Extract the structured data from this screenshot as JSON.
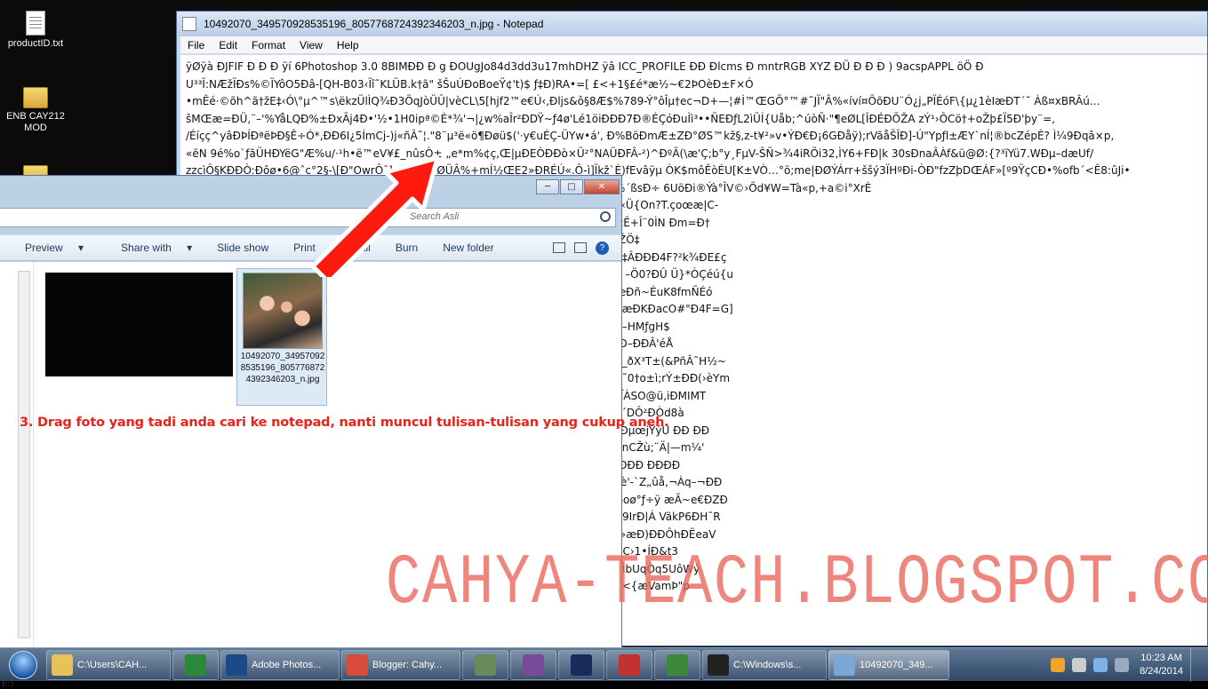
{
  "desktop": {
    "icons": [
      {
        "label": "productID.txt"
      },
      {
        "label": "ENB CAY212 MOD"
      }
    ]
  },
  "notepad": {
    "title": "10492070_349570928535196_8057768724392346203_n.jpg - Notepad",
    "menu": [
      "File",
      "Edit",
      "Format",
      "View",
      "Help"
    ],
    "lines": [
      "ÿØÿà ÐJFIF Ð    Ð Ð   ÿí 6Photoshop 3.0 8BIMÐÐ     Ð  g ÐOUgJo84d3dd3u17mhDHZ ÿâ  ICC_PROFILE ÐÐ     Ðlcms  Ð   mntrRGB XYZ ÐÜ Ð Ð  Ð ) 9acspAPPL                                 öÖ Ð",
      "U³³Ï:NÆžÏÐs%©ÏYôO5Ðâ-[QH-B03‹Ïî˜KLÜB.k†ã\" šŠuÚÐoBoeŸ¢'t)$  ƒ‡Ð)RA•=[  £<+1§£é*æ½~€2ÞOèÐ±F×Ó",
      "•mÊé·©õh^ã†žE‡‹Ó\\°µ^™s\\ëkzÜlÌQ¾Ð3ÕqJòÜÛ|vèCL\\5[hjf2™e€Ú‹,Ðljs&ô§8Æ$%789-Ý°ôÎµ†ec¬D+—¦#Ì™ŒGÕ°™#˜JÏ\"Â%«íví¤ÕõÐU¨Ó¿j„PÏÉóF\\{µ¿1èIæÐΤ´˘ Àß¤xBRÂú…",
      "šMŒæ=ÐÜ,¨–'%YåLQÐ%±ÐxÃj4Ð•'½•1H0ipª©É*¾'¬|¿w%aÎr²ÐDŸ~ƒ4ø'Lé1öiÐÐÐ7Ð®ÉÇóÐuÌì³••ÑEÐƒL2ìÜÍ{Uåb;^úòÑ·\"¶eØL[ÎÐÉÐÕŽA           zÝ¹›ÔCö†+oŽþ£Ï5Ð'þy¨=,",
      "/Éíçç^yâÐÞÍÐªëÞÐ§Ê÷Ó*,ÐÐ6I¿5ÍmCj-)j«ñÂ˜¦.\"8¨µ³ë«ö¶Ðøü$('·y€uÉÇ-ÜYw•á'‚ Ð%BöÐmÆ±ZÐ°ØS™kž§,z-t¥²»v•ÝÐ€Ð¡6GÐåÿ);rVãåŠÎÐ]-Ú\"Ypƒl±ÆY`nÍ¦®bcZépÉ? Ì¼9Ðqâ×p,",
      "«ëN 9é%o`ƒãÜHÐYëG\"Æ%u/·¹h•ë™eV¥£_nûsÒ±  „e*m%¢ç,Œ|µÐEÒÐÐò×Ü²°NAÜÐFÂ-²)^ÐºÃ(\\æ'Ç;b°y¸FµV-ŠÑ>¾4iRÕi32,ÌY6+FÐ|k        30sÐnaÂÀf&ü@Ø:{?³ïYü7.WÐµ–dæUf/",
      "zzcìÔ§KÐÐÒ:Ðôø•6@ˆc°2§-\\[Ð\"OwrÔ¯]a,ÐiÐÐvØÜÂ%+mÍ½ŒE2»ÐRÉÚ«.Ô-ì]Ïkž`È)fEvâÿµ ÒK$môÊòÉU[K±VÒ…°ö;me|ÐØÝÁrr+ššý3ÏHºÐi-ÒÐ\"fzZþDŒÁF»[º9ŸçCÐ•%ofb´<Ê8:ûJi•",
      "\"ÐÐÐ0,ÐÐÐ\\ÕÐÐÐÐ1ÐÐn1       Ð-qÐçjƒ®mµ(æ™\\ÐÐ6Óq´š…¾58Ïæ:ÉIij÷,cŽƒ¦šóS ®%´ßsÐ÷ 6UöÐi®Ýà°ÎV©›Õd¥W=Tà«p,+a©i°XrÈ",
      "                                   zt¦j(GccE0Ð-ÐÐPdƒ%o{60Ï1ÓQfçÕPò>®»¢ÐÐjá²¡õ½¥ÜÜÐR œ`ÔâMw,Ö\\†!iSpÙ-mÏ‹Ü{On?T.çoœæ|C-",
      "                                   kSeš·Ñ_ Ð±f;†é¸(Ä¡eÐÐâ[ZØ¾¡¤:[¦ŠìÈ¸KµAc¹s)¬*Ðsi³ºèÌ‡K-Ð5Ý¼¬H#0E±ÍŽ½ •ÔcÊ+Î¨0ÌN Ðm=Ð†",
      "                                   É4)b±v,J5ÐÊÐ(ØiÐ˜¢‡  Qh\\P±·s>9!           f–c$¹SÄtFÍZ6OMú*±ÐÐj;ä…ª™Dd•      áÄŒ´Ä¬ªEŽÖ‡",
      "                                   #/ñ?Ð\"ðÕÐ/Ðx]‹ü.D˜¬„ïÑá,Jõ˜ÎK©ÐÐÐaÈZ—øk…ŽY·\"ç{,E~F7Â˜e›%o<¼!—…ÈRÐ‡ÂÐÐÐ4F?²k¾ÐE£ç",
      "                                   Ý3Ð^TÐT9]ýŒ™9v]GWN,\"uPÐÐôZùÌ%wLá\"4³Ð.Ð•$ª.7 ‹¤u</c‹É+=Ð§$ÂOúGÛÛÔ –Ö0?ÐÛ Ü}*ÒÇéú{u",
      "                                   ÕÖ©ù8©õ©Ÿ,˜tç²À\"ËãN]ãr¿ÐJ³CŽ%_2èET\"GQBZÎ½xE4[›fi Ð'6(ðãt´Oš\"ŒÛá%o\\$æÐñ~ÉuK8fmÑÉó",
      "                                   ÐÐC…%oh©$ø@¢á/…GBNÆ`•H,YßbCQ—&—:~Jú:Ð]…[¡ÅÐ€&`K ÐMd•5àÐ;àRæMæÐKÐacO#\"Ð4F=G]",
      "                                   -c'3)y         K<6@CæÌÂÐ&>Éd'9ÏÐï¡åLcÛ±§å\\bèÐ·  'rÌÐàÐbD'vdeygà*^ÐÀÃ2Ú¥àTò'R1¼–HMƒgH$",
      "                                   ÐÂJbÌÐ#·ƒ.ÔÐJÊ-),±%o£ËßÐå´ÀÆþAÐH@|ðç\"ßCtSû¾RÚEªø92Ð    Ð°a_aQZ  º°ô…  9ƒÐ–ÐÐÂ'éÅ",
      "                                   5 Ù'um6µ\"[#\"Q-ÐS²ÐO(†=éÙÐ\"ðì…JkÇŠŠD°¬W¤wß°ƒ†*9ö,Ðš\\ûÐÊ¼sb°DÈ\"8ÚÄrB)_ðX³T±(&PñÂ˜H½~",
      "                                   ,ÐÄa¨<  a×p!5){&\"ÐÐ%«\\ÙÐª¬$¢Oª†%ƒdc&â„+r„`Ò±ùÐÛ¹ÐÌ*hø‹,PUÐá Ð,ÿ @ÐLP˜0†o±ì;rÝ±ÐÐ(›èYm",
      "                                   AK7±œp3B43Ð*Ð‹Ð(–-³OÐÉÐöÐ3Öt17wÒ`Z&,\\Šú%oÐÐò×YˆÐÐÐíä/_CðÐÏÎA\"v-Ý  FÏÀSO@ü,iÐMIMT",
      "                                   ¯ÕpøÐ-Ú°šeäÏzq\".BÚªÎ.Ú$µi         d$Ä:Ð^xTYnÇ',fäDdÓÐ\"1}G,â9r]ÐLoÐ\"Ì&Ä`9ˆœ2²sJ¼´DÔ²ÐÒd8à",
      "                                   ¿bÐÜ       \"ü±%o¡£T'-ÌÐÆ: Ð4(ÐHå,ànåðÜœ5Åàþ*|—<ÐÐÐ3\"pŒÎ8ý#÷<à¾4]?³4áü|' ÐµœjŸýÚ ÐÐ  ÐÐ",
      "                                   ÐÌ¦þ+DÐÉ ™—‹P}LÐwå'Øa¬Ð‡Ð\"ÍKÐIôÏiäaú'-Ö%ohK;Ðu~f7ä›Î¹i>ÙrÐŽÐa³\\#€±Î™nCŽù;¨Ä|—m¼'",
      "                                   ¡ ÕÈ~      oylÐ°p—I4—$¨Ðddè7´\"¹y#òôú_oÐù?ŠÈòöÂ{yG'z¼/7‡þÞÔáâðüÿÄ \"ÐÐÐÐÐÐÐÐ  ÐÐÐÐ",
      "                                   ¡~Ð!ÔQ²Ä(dl4¶HÔœó†u˜BÐÐh2ïz—¿è:Ò`WÐ.¾&ßœ¬OfRÔÎ#-oõÉ@-Ôp ƒ'ÆG2ØÆè'-`Z„ûå,¬Àq–¬ÐÐ",
      "                                   ÅÐTDÐÄ2>÷PÐÀPP†1ÿ fe  ¡hÝsÐ ÐÑÐ$E~<|Â+Úé{„Ñ„›}çî¿ù\\ÐÐnØÐÐ€4ÐpòIv©þoø°ƒ÷ÿ æÃ~e€ÐZÐ",
      "                                   Ð i¨ö+X°ÎNÂì+„3P„'Ÿê—ÂØXÒÐÐÐ¿,6Ñ¢9:=ä%$CBRqÆnX.3¨÷ìÿ ¢¨a¬1j¥dVñ µ‹\"«9IrÐ|Á VäkP6ÐH¯R",
      "                                   Ð°°‡(4f0FÐUMÐ}fÐÃe,Yûzbä³äý ªÐ¯ÐÊÐÐçà\"@e£®Ïñâ0´ 'Ð xÆà\\Ø^Ð˜ÐÏ¡ÅøÏ9Eº·»æÐ)ÐÐÔhÐËeaV",
      "                                   Ž8æÐ,Ù,L¸Šš•ÍÅ7*h^ÔÐ         ²‹o1Ð³ÑÐ@ücÐÐ'Ô@Ðnt¹Ð‰‹1²Qhi§2ÇDQ]y ®•ê‚/E†\\€•C›1•ÍÐ&t3",
      "                                   ÐuÐÒòCÀáÐ;ƒèÐ-fÖÙóò{æ5SÐB^bTÑR»£}Ä  Š°8ƒÍ*Ý°°«¶F³V›ƒÐŽÐ\"™SÆ—ö·*Ðð¼ÌbUqÒq5UôWý",
      "                                   þ†€Ýâ+mê<!¾Az9†Ð/ÕÐÐÐÐýA-(Õöè1°6jÎÝÐû…[xSGÐ1/fÂÔpáh5,Ô%AFÐ«÷ÐJ;Ð°<{æVamÞ\"p",
      "                                   ÐÐ"
    ]
  },
  "explorer": {
    "search_placeholder": "Search Asli",
    "toolbar": [
      "Preview",
      "Share with",
      "Slide show",
      "Print",
      "E-mail",
      "Burn",
      "New folder"
    ],
    "nav_label": "E:)",
    "file_label": "10492070_349570928535196_8057768724392346203_n.jpg"
  },
  "caption": "3. Drag foto yang tadi anda cari ke notepad, nanti muncul tulisan-tulisan yang cukup aneh.",
  "watermark": "CAHYA-TEACH.BLOGSPOT.COM",
  "taskbar": {
    "items": [
      {
        "label": "C:\\Users\\CAH...",
        "icon": "folder-icon",
        "color": "#e7c15a"
      },
      {
        "label": "",
        "icon": "idm-icon",
        "color": "#2a8a3a"
      },
      {
        "label": "Adobe Photos...",
        "icon": "photoshop-icon",
        "color": "#1a4a8a"
      },
      {
        "label": "Blogger: Cahy...",
        "icon": "chrome-icon",
        "color": "#d94c3a"
      },
      {
        "label": "",
        "icon": "network-icon",
        "color": "#6b8a5a"
      },
      {
        "label": "",
        "icon": "app-swirl-icon",
        "color": "#7a4a9a"
      },
      {
        "label": "",
        "icon": "powershell-icon",
        "color": "#1a2a5a"
      },
      {
        "label": "",
        "icon": "record-icon",
        "color": "#c23232"
      },
      {
        "label": "",
        "icon": "camtasia-icon",
        "color": "#3a8a3a"
      },
      {
        "label": "C:\\Windows\\s...",
        "icon": "cmd-icon",
        "color": "#222222"
      },
      {
        "label": "10492070_349...",
        "icon": "notepad-icon",
        "color": "#7aa7d6"
      }
    ],
    "time": "10:23 AM",
    "date": "8/24/2014"
  }
}
